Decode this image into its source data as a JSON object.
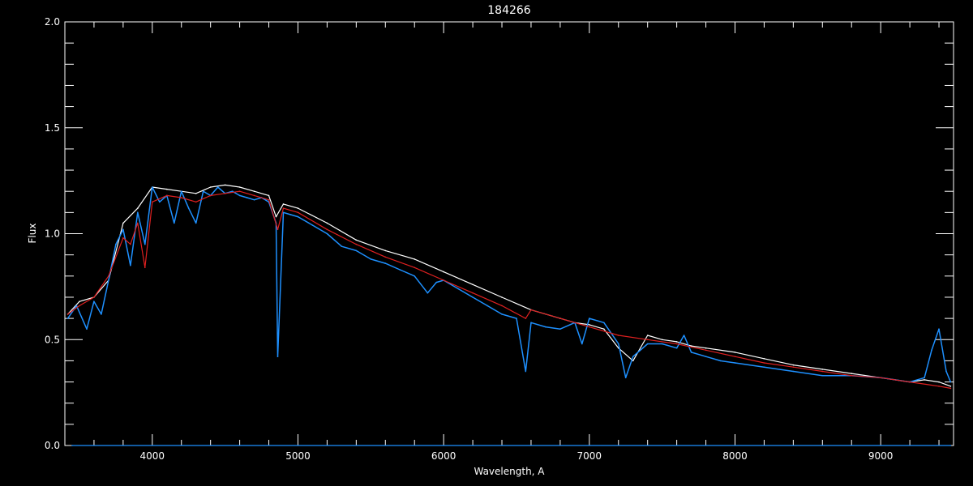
{
  "chart_data": {
    "type": "line",
    "title": "184266",
    "xlabel": "Wavelength, A",
    "ylabel": "Flux",
    "xlim": [
      3400,
      9500
    ],
    "ylim": [
      0.0,
      2.0
    ],
    "x_ticks": [
      4000,
      5000,
      6000,
      7000,
      8000,
      9000
    ],
    "x_tick_labels": [
      "4000",
      "5000",
      "6000",
      "7000",
      "8000",
      "9000"
    ],
    "y_ticks": [
      0.0,
      0.5,
      1.0,
      1.5,
      2.0
    ],
    "y_tick_labels": [
      "0.0",
      "0.5",
      "1.0",
      "1.5",
      "2.0"
    ],
    "grid": false,
    "background": "#000000",
    "foreground": "#ffffff",
    "series": [
      {
        "color": "#ffffff",
        "x": [
          3420,
          3500,
          3600,
          3700,
          3800,
          3900,
          4000,
          4100,
          4200,
          4300,
          4400,
          4500,
          4600,
          4700,
          4800,
          4850,
          4900,
          5000,
          5200,
          5400,
          5600,
          5800,
          6000,
          6200,
          6400,
          6600,
          6800,
          6900,
          7000,
          7100,
          7200,
          7300,
          7400,
          7500,
          7600,
          7700,
          7800,
          8000,
          8200,
          8400,
          8600,
          8800,
          9000,
          9200,
          9300,
          9400,
          9480
        ],
        "y": [
          0.62,
          0.68,
          0.7,
          0.78,
          1.05,
          1.12,
          1.22,
          1.21,
          1.2,
          1.19,
          1.22,
          1.23,
          1.22,
          1.2,
          1.18,
          1.08,
          1.14,
          1.12,
          1.05,
          0.97,
          0.92,
          0.88,
          0.82,
          0.76,
          0.7,
          0.64,
          0.6,
          0.58,
          0.57,
          0.55,
          0.46,
          0.4,
          0.52,
          0.5,
          0.49,
          0.47,
          0.46,
          0.44,
          0.41,
          0.38,
          0.36,
          0.34,
          0.32,
          0.3,
          0.31,
          0.3,
          0.28
        ]
      },
      {
        "color": "#1e90ff",
        "x": [
          3420,
          3480,
          3550,
          3600,
          3650,
          3700,
          3750,
          3800,
          3850,
          3900,
          3950,
          4000,
          4050,
          4100,
          4150,
          4200,
          4250,
          4300,
          4350,
          4400,
          4450,
          4500,
          4550,
          4600,
          4650,
          4700,
          4750,
          4800,
          4850,
          4861,
          4900,
          4950,
          5000,
          5100,
          5200,
          5300,
          5400,
          5500,
          5600,
          5700,
          5800,
          5890,
          5950,
          6000,
          6100,
          6200,
          6300,
          6400,
          6500,
          6563,
          6600,
          6700,
          6800,
          6900,
          6950,
          7000,
          7100,
          7200,
          7250,
          7300,
          7400,
          7500,
          7600,
          7650,
          7700,
          7800,
          7900,
          8000,
          8200,
          8400,
          8600,
          8800,
          9000,
          9100,
          9200,
          9300,
          9350,
          9400,
          9450,
          9480
        ],
        "y": [
          0.6,
          0.66,
          0.55,
          0.68,
          0.62,
          0.78,
          0.95,
          1.02,
          0.85,
          1.1,
          0.95,
          1.22,
          1.15,
          1.18,
          1.05,
          1.2,
          1.12,
          1.05,
          1.2,
          1.18,
          1.22,
          1.19,
          1.2,
          1.18,
          1.17,
          1.16,
          1.17,
          1.15,
          1.05,
          0.42,
          1.1,
          1.09,
          1.08,
          1.04,
          1.0,
          0.94,
          0.92,
          0.88,
          0.86,
          0.83,
          0.8,
          0.72,
          0.77,
          0.78,
          0.74,
          0.7,
          0.66,
          0.62,
          0.6,
          0.35,
          0.58,
          0.56,
          0.55,
          0.58,
          0.48,
          0.6,
          0.58,
          0.48,
          0.32,
          0.42,
          0.48,
          0.48,
          0.46,
          0.52,
          0.44,
          0.42,
          0.4,
          0.39,
          0.37,
          0.35,
          0.33,
          0.33,
          0.32,
          0.31,
          0.3,
          0.32,
          0.45,
          0.55,
          0.35,
          0.3
        ]
      },
      {
        "color": "#e02020",
        "x": [
          3420,
          3500,
          3600,
          3700,
          3800,
          3850,
          3900,
          3950,
          4000,
          4100,
          4200,
          4300,
          4400,
          4500,
          4600,
          4700,
          4800,
          4861,
          4900,
          5000,
          5200,
          5400,
          5600,
          5800,
          6000,
          6200,
          6400,
          6563,
          6600,
          6800,
          7000,
          7200,
          7400,
          7600,
          7800,
          8000,
          8200,
          8400,
          8600,
          8800,
          9000,
          9200,
          9400,
          9480
        ],
        "y": [
          0.62,
          0.66,
          0.7,
          0.8,
          0.98,
          0.95,
          1.05,
          0.84,
          1.15,
          1.18,
          1.17,
          1.15,
          1.18,
          1.19,
          1.2,
          1.18,
          1.16,
          1.02,
          1.12,
          1.1,
          1.02,
          0.95,
          0.89,
          0.84,
          0.78,
          0.72,
          0.66,
          0.6,
          0.64,
          0.6,
          0.56,
          0.52,
          0.5,
          0.48,
          0.45,
          0.42,
          0.39,
          0.37,
          0.35,
          0.33,
          0.32,
          0.3,
          0.28,
          0.27
        ]
      },
      {
        "color": "#1e90ff",
        "x": [
          3450,
          9480
        ],
        "y": [
          0.0,
          0.0
        ]
      }
    ]
  }
}
